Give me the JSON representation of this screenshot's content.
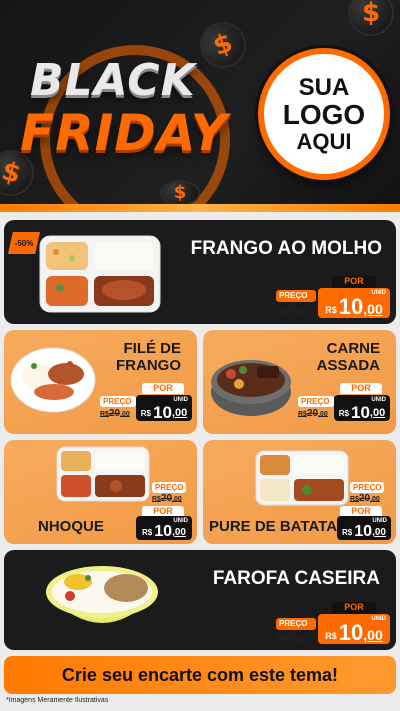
{
  "header": {
    "title_line1": "BLACK",
    "title_line2": "FRIDAY",
    "logo_line1": "SUA",
    "logo_line2": "LOGO",
    "logo_line3": "AQUI",
    "coin_symbol": "$"
  },
  "discount_badge": "-50%",
  "price_labels": {
    "por": "POR",
    "preco": "PREÇO",
    "unid": "UNID",
    "currency": "R$"
  },
  "items": [
    {
      "name": "FRANGO AO MOLHO",
      "old_price_int": "20",
      "old_price_dec": ",00",
      "new_price_int": "10",
      "new_price_dec": ",00",
      "icon": "meal-tray-icon"
    },
    {
      "name_line1": "FILÉ DE",
      "name_line2": "FRANGO",
      "old_price_int": "20",
      "old_price_dec": ",00",
      "new_price_int": "10",
      "new_price_dec": ",00",
      "icon": "plate-icon"
    },
    {
      "name_line1": "CARNE",
      "name_line2": "ASSADA",
      "old_price_int": "20",
      "old_price_dec": ",00",
      "new_price_int": "10",
      "new_price_dec": ",00",
      "icon": "bowl-icon"
    },
    {
      "name": "NHOQUE",
      "old_price_int": "20",
      "old_price_dec": ",00",
      "new_price_int": "10",
      "new_price_dec": ",00",
      "icon": "meal-tray-icon"
    },
    {
      "name": "PURE DE BATATA",
      "old_price_int": "20",
      "old_price_dec": ",00",
      "new_price_int": "10",
      "new_price_dec": ",00",
      "icon": "meal-tray-icon"
    },
    {
      "name": "FAROFA CASEIRA",
      "old_price_int": "20",
      "old_price_dec": ",00",
      "new_price_int": "10",
      "new_price_dec": ",00",
      "icon": "bowl-icon"
    }
  ],
  "cta": "Crie seu encarte com este tema!",
  "disclaimer": "*Imagens Meramente Ilustrativas",
  "colors": {
    "accent": "#ff6a00",
    "dark": "#1b1b1b",
    "orange_card": "#f29a45"
  }
}
